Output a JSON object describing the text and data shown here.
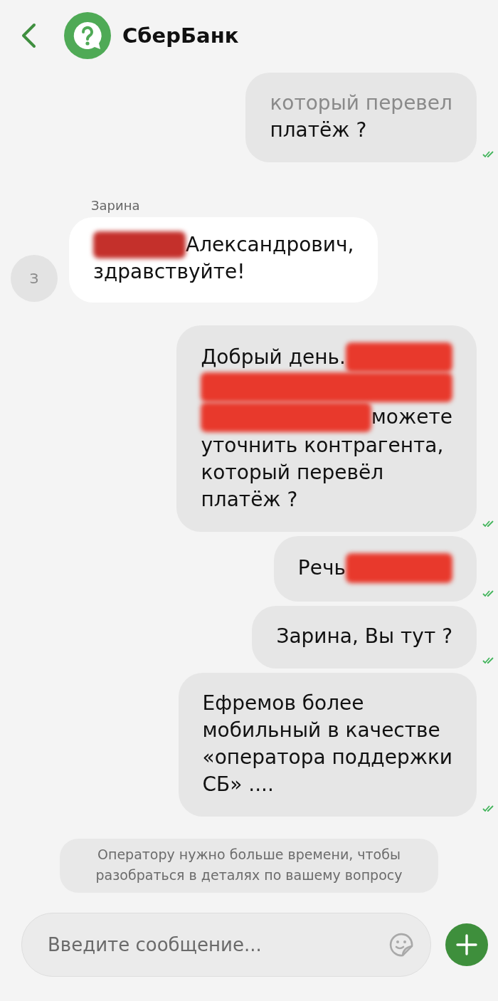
{
  "header": {
    "title": "СберБанк"
  },
  "messages": [
    {
      "kind": "outgoing",
      "read": true,
      "lines": [
        [
          {
            "kind": "faded",
            "text": "который перевел"
          }
        ],
        [
          {
            "kind": "text",
            "text": "платёж ?"
          }
        ]
      ]
    },
    {
      "kind": "incoming",
      "sender": "Зарина",
      "avatar": "З",
      "lines": [
        [
          {
            "kind": "redaction"
          },
          {
            "kind": "text",
            "text": "Александрович,"
          }
        ],
        [
          {
            "kind": "text",
            "text": "здравствуйте!"
          }
        ]
      ]
    },
    {
      "kind": "outgoing",
      "read": true,
      "lines": [
        [
          {
            "kind": "text",
            "text": "Добрый день."
          },
          {
            "kind": "redaction"
          }
        ],
        [
          {
            "kind": "redaction"
          }
        ],
        [
          {
            "kind": "redaction"
          },
          {
            "kind": "text",
            "text": "можете"
          }
        ],
        [
          {
            "kind": "text",
            "text": "уточнить контрагента,"
          }
        ],
        [
          {
            "kind": "text",
            "text": "который перевёл"
          }
        ],
        [
          {
            "kind": "text",
            "text": "платёж ?"
          }
        ]
      ]
    },
    {
      "kind": "outgoing",
      "read": true,
      "lines": [
        [
          {
            "kind": "text",
            "text": "Речь"
          },
          {
            "kind": "redaction"
          }
        ]
      ]
    },
    {
      "kind": "outgoing",
      "read": true,
      "lines": [
        [
          {
            "kind": "text",
            "text": "Зарина, Вы тут ?"
          }
        ]
      ]
    },
    {
      "kind": "outgoing",
      "read": true,
      "lines": [
        [
          {
            "kind": "text",
            "text": "Ефремов более"
          }
        ],
        [
          {
            "kind": "text",
            "text": "мобильный в качестве"
          }
        ],
        [
          {
            "kind": "text",
            "text": "«оператора поддержки"
          }
        ],
        [
          {
            "kind": "text",
            "text": "СБ» ...."
          }
        ]
      ]
    }
  ],
  "notice": "Оператору нужно больше времени, чтобы разобраться в деталях по вашему вопросу",
  "composer": {
    "placeholder": "Введите сообщение..."
  }
}
